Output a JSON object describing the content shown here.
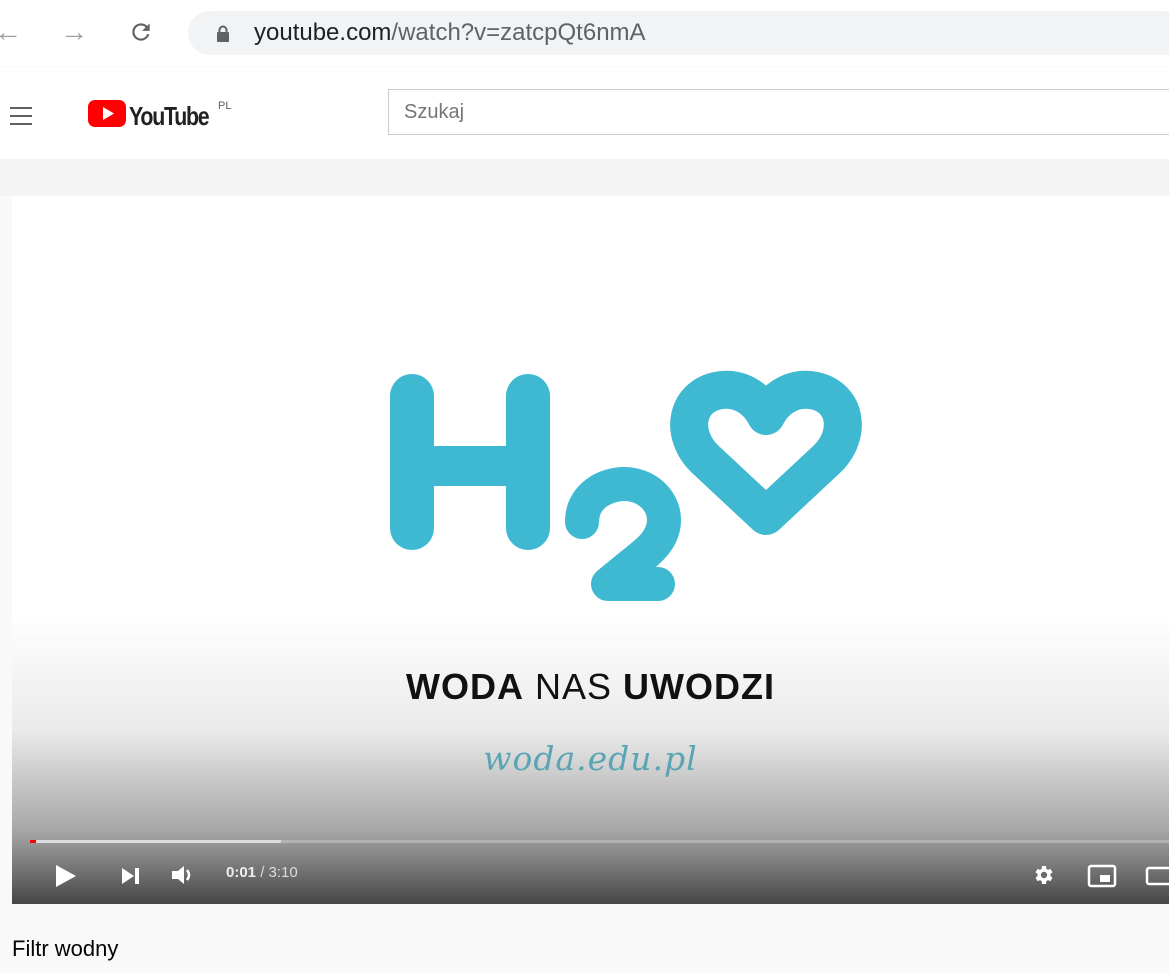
{
  "browser": {
    "url_host": "youtube.com",
    "url_path": "/watch?v=zatcpQt6nmA"
  },
  "header": {
    "logo_text": "YouTube",
    "country_code": "PL",
    "search_placeholder": "Szukaj"
  },
  "video": {
    "logo_text": "H2O",
    "tagline_1": "WODA",
    "tagline_2": "NAS",
    "tagline_3": "UWODZI",
    "website": "woda.edu.pl",
    "current_time": "0:01",
    "time_separator": " / ",
    "duration": "3:10",
    "played_fraction": 0.005,
    "buffered_fraction": 0.22
  },
  "title": "Filtr wodny",
  "colors": {
    "logo_blue": "#3fb8d2",
    "youtube_red": "#ff0000"
  }
}
